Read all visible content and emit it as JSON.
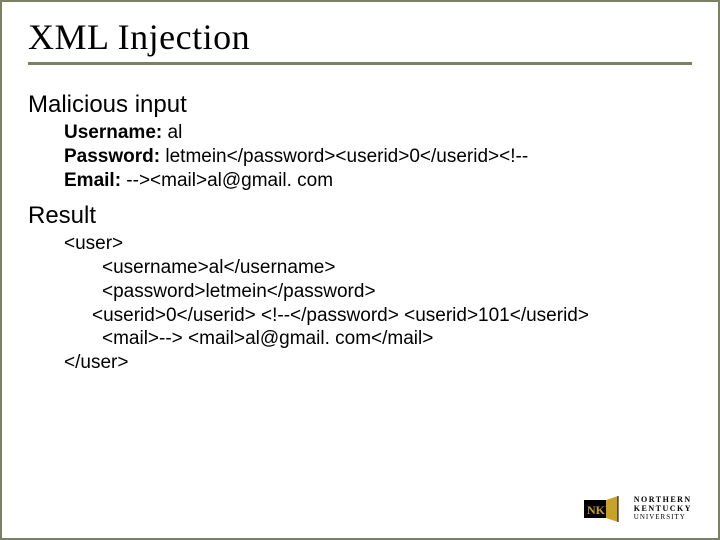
{
  "title": "XML Injection",
  "section1": {
    "heading": "Malicious input",
    "username_label": "Username:",
    "username_value": " al",
    "password_label": "Password:",
    "password_value": " letmein</password><userid>0</userid><!--",
    "email_label": "Email:",
    "email_value": " --><mail>al@gmail. com"
  },
  "section2": {
    "heading": "Result",
    "line1": "<user>",
    "line2": "<username>al</username>",
    "line3": "<password>letmein</password>",
    "line4": "<userid>0</userid> <!--</password> <userid>101</userid>",
    "line5": "<mail>--> <mail>al@gmail. com</mail>",
    "line6": "</user>"
  },
  "logo": {
    "nku": "NKU",
    "line1": "NORTHERN",
    "line2": "KENTUCKY",
    "line3": "UNIVERSITY"
  },
  "colors": {
    "frame": "#7a8266",
    "gold": "#c9a227"
  }
}
